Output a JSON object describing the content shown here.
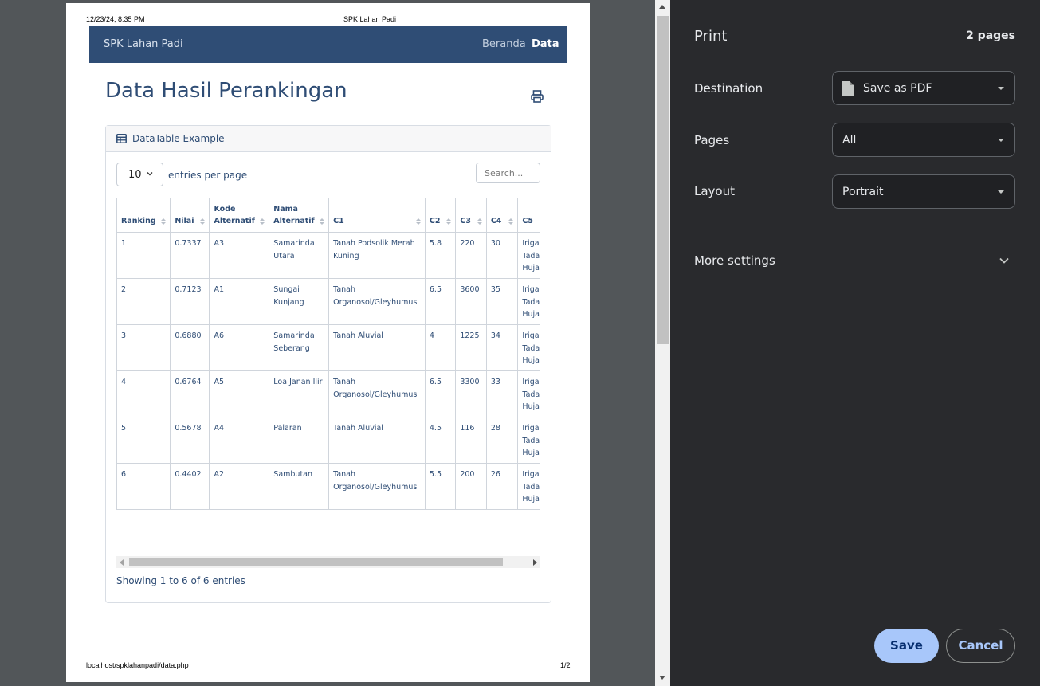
{
  "preview": {
    "header_date": "12/23/24, 8:35 PM",
    "header_title": "SPK Lahan Padi",
    "footer_url": "localhost/spklahanpadi/data.php",
    "footer_page": "1/2",
    "navbar": {
      "brand": "SPK Lahan Padi",
      "links": [
        "Beranda",
        "Data"
      ],
      "active": "Data"
    },
    "heading": "Data Hasil Perankingan",
    "card_title": "DataTable Example",
    "per_page_value": "10",
    "per_page_label": "entries per page",
    "search_placeholder": "Search...",
    "columns": [
      "Ranking",
      "Nilai",
      "Kode Alternatif",
      "Nama Alternatif",
      "C1",
      "C2",
      "C3",
      "C4",
      "C5"
    ],
    "rows": [
      [
        "1",
        "0.7337",
        "A3",
        "Samarinda Utara",
        "Tanah Podsolik Merah Kuning",
        "5.8",
        "220",
        "30",
        "Irigasi Tadah Hujan"
      ],
      [
        "2",
        "0.7123",
        "A1",
        "Sungai Kunjang",
        "Tanah Organosol/Gleyhumus",
        "6.5",
        "3600",
        "35",
        "Irigasi Tadah Hujan"
      ],
      [
        "3",
        "0.6880",
        "A6",
        "Samarinda Seberang",
        "Tanah Aluvial",
        "4",
        "1225",
        "34",
        "Irigasi Tadah Hujan"
      ],
      [
        "4",
        "0.6764",
        "A5",
        "Loa Janan Ilir",
        "Tanah Organosol/Gleyhumus",
        "6.5",
        "3300",
        "33",
        "Irigasi Tadah Hujan"
      ],
      [
        "5",
        "0.5678",
        "A4",
        "Palaran",
        "Tanah Aluvial",
        "4.5",
        "116",
        "28",
        "Irigasi Tadah Hujan"
      ],
      [
        "6",
        "0.4402",
        "A2",
        "Sambutan",
        "Tanah Organosol/Gleyhumus",
        "5.5",
        "200",
        "26",
        "Irigasi Tadah Hujan"
      ]
    ],
    "showing_text": "Showing 1 to 6 of 6 entries",
    "colors": {
      "navbar": "#2f4d75",
      "text": "#2f4d75"
    }
  },
  "panel": {
    "title": "Print",
    "sheet_count": "2 pages",
    "destination_label": "Destination",
    "destination_value": "Save as PDF",
    "pages_label": "Pages",
    "pages_value": "All",
    "layout_label": "Layout",
    "layout_value": "Portrait",
    "more_settings": "More settings",
    "save_label": "Save",
    "cancel_label": "Cancel",
    "colors": {
      "background": "#292a2d",
      "save_bg": "#a8c7fa",
      "accent": "#a8c7fa"
    }
  }
}
